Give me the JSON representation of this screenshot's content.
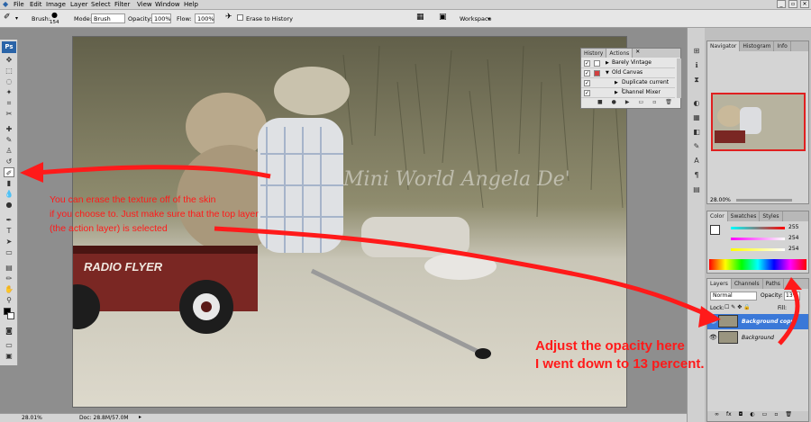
{
  "menu": [
    "File",
    "Edit",
    "Image",
    "Layer",
    "Select",
    "Filter",
    "View",
    "Window",
    "Help"
  ],
  "options": {
    "brush_label": "Brush:",
    "brush_size": "154",
    "mode_label": "Mode:",
    "mode_value": "Brush",
    "opacity_label": "Opacity:",
    "opacity_value": "100%",
    "flow_label": "Flow:",
    "flow_value": "100%",
    "erase_history": "Erase to History",
    "workspace": "Workspace"
  },
  "toolbox": {
    "logo": "Ps"
  },
  "actions_panel": {
    "tabs": [
      "History",
      "Actions"
    ],
    "rows": [
      "Barely Vintage",
      "Old Canvas",
      "Duplicate current l...",
      "Channel Mixer"
    ]
  },
  "navigator": {
    "tabs": [
      "Navigator",
      "Histogram",
      "Info"
    ],
    "zoom": "28.00%"
  },
  "color": {
    "tabs": [
      "Color",
      "Swatches",
      "Styles"
    ],
    "r": "255",
    "g": "254",
    "b": "254"
  },
  "layers": {
    "tabs": [
      "Layers",
      "Channels",
      "Paths"
    ],
    "blend": "Normal",
    "opacity_label": "Opacity:",
    "opacity_value": "13%",
    "lock_label": "Lock:",
    "fill_label": "Fill:",
    "rows": [
      "Background copy",
      "Background"
    ]
  },
  "status": {
    "zoom": "28.01%",
    "doc": "Doc: 28.8M/57.0M"
  },
  "photo": {
    "watermark": "Mini World Angela De'",
    "wagon_text": "RADIO FLYER"
  },
  "annotations": {
    "left_note": [
      "You can erase the texture off of the skin",
      "if you choose to. Just make sure that the top layer",
      "(the action layer) is selected"
    ],
    "right_note": [
      "Adjust the opacity here",
      "I went down to 13 percent."
    ]
  },
  "colors": {
    "annotation": "#ff1a1a",
    "layer_selected": "#3a78d8",
    "ps_blue": "#2a64a8"
  }
}
